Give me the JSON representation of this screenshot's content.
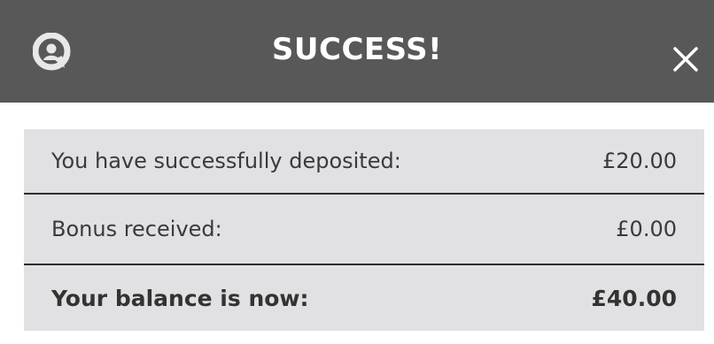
{
  "header": {
    "title": "SUCCESS!",
    "logo_icon": "chat-bubble-logo-icon",
    "close_icon": "close-icon"
  },
  "summary": {
    "rows": [
      {
        "label": "You have successfully deposited:",
        "value": "£20.00"
      },
      {
        "label": "Bonus received:",
        "value": "£0.00"
      },
      {
        "label": "Your balance is now:",
        "value": "£40.00"
      }
    ]
  },
  "colors": {
    "header_bg": "#585858",
    "panel_bg": "#e1e0e3",
    "divider": "#2d2d2d",
    "text": "#3a3a3a",
    "title": "#ffffff"
  }
}
